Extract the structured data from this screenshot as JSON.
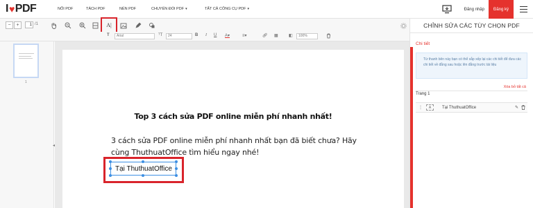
{
  "brand": {
    "name": "PDF",
    "accent": "#e5322d"
  },
  "nav": [
    {
      "label": "NỐI PDF"
    },
    {
      "label": "TÁCH PDF"
    },
    {
      "label": "NÉN PDF"
    },
    {
      "label": "CHUYỂN ĐỔI PDF"
    },
    {
      "label": "TẤT CẢ CÔNG CỤ PDF"
    }
  ],
  "header": {
    "login": "Đăng nhập",
    "signup": "Đăng ký"
  },
  "toolbar": {
    "page_current": "1",
    "page_total": "/1",
    "icons": [
      "zoom-out-icon",
      "hand-icon",
      "zoom-out-magnifier-icon",
      "zoom-in-icon",
      "fit-page-icon",
      "add-text-icon",
      "add-image-icon",
      "draw-icon",
      "shapes-icon",
      "settings-icon"
    ]
  },
  "format": {
    "font": "Arial",
    "size": "24",
    "zoom": "100%"
  },
  "sidebar": {
    "page_number": "1"
  },
  "document": {
    "heading": "Top 3 cách sửa PDF online miễn phí nhanh nhất!",
    "paragraph": "3 cách sửa PDF online miễn phí nhanh nhất bạn đã biết chưa? Hãy cùng ThuthuatOffice tìm hiểu ngay nhé!",
    "textbox": "Tại ThuthuatOffice"
  },
  "panel": {
    "title": "CHỈNH SỬA CÁC TÙY CHỌN PDF",
    "detail_label": "Chi tiết",
    "info": "Từ thanh bên này bạn có thể sắp xếp lại các chi tiết để đưa các chi tiết về đằng sau hoặc lên đằng trước tài liệu",
    "clear_all": "Xóa bỏ tất cả",
    "page_label": "Trang 1",
    "item_type": "A",
    "item_label": "Tại ThuthuatOffice"
  }
}
